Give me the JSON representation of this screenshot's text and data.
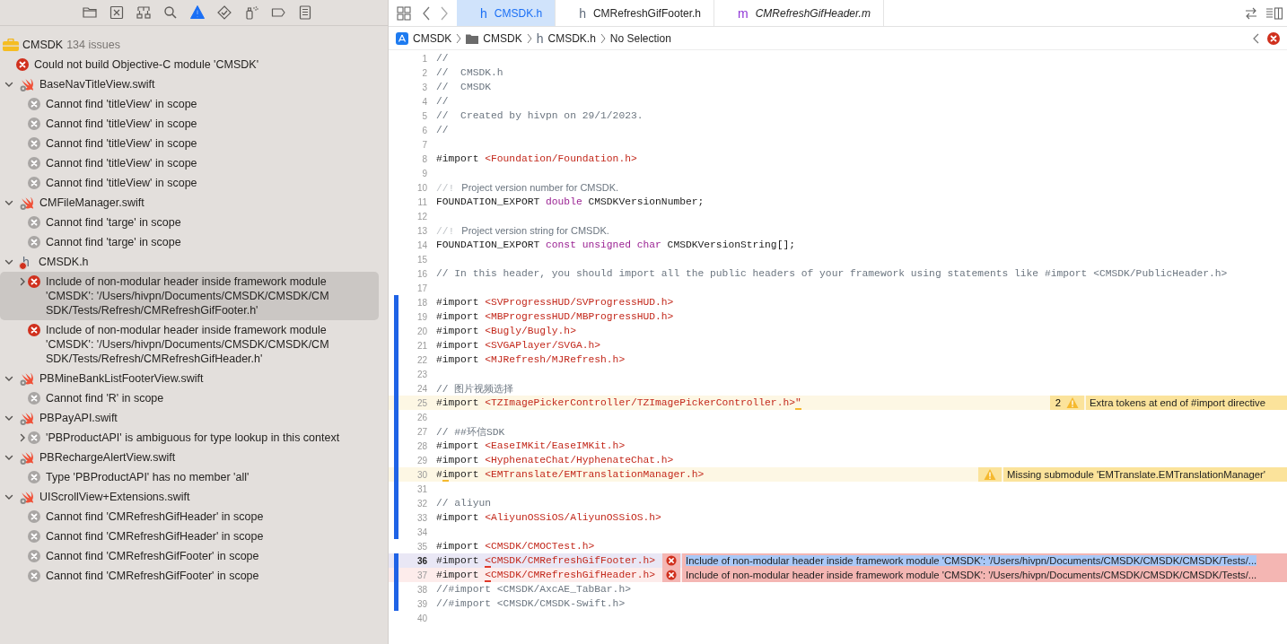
{
  "navigator_tabs": [
    {
      "kind": "project",
      "selected": false
    },
    {
      "kind": "source_control",
      "selected": false
    },
    {
      "kind": "symbols",
      "selected": false
    },
    {
      "kind": "find",
      "selected": false
    },
    {
      "kind": "issues",
      "selected": true
    },
    {
      "kind": "tests",
      "selected": false
    },
    {
      "kind": "debug",
      "selected": false
    },
    {
      "kind": "breakpoints",
      "selected": false
    },
    {
      "kind": "reports",
      "selected": false
    }
  ],
  "issues": {
    "project": "CMSDK",
    "count": "134 issues",
    "items": [
      {
        "kind": "error",
        "text": "Could not build Objective-C module 'CMSDK'",
        "selected": false
      },
      {
        "kind": "swift_file",
        "name": "BaseNavTitleView.swift",
        "expanded": true,
        "selected": false,
        "children": [
          {
            "kind": "stale",
            "text": "Cannot find 'titleView' in scope",
            "selected": false
          },
          {
            "kind": "stale",
            "text": "Cannot find 'titleView' in scope",
            "selected": false
          },
          {
            "kind": "stale",
            "text": "Cannot find 'titleView' in scope",
            "selected": false
          },
          {
            "kind": "stale",
            "text": "Cannot find 'titleView' in scope",
            "selected": false
          },
          {
            "kind": "stale",
            "text": "Cannot find 'titleView' in scope",
            "selected": false
          }
        ]
      },
      {
        "kind": "swift_file",
        "name": "CMFileManager.swift",
        "expanded": true,
        "selected": false,
        "children": [
          {
            "kind": "stale",
            "text": "Cannot find 'targe' in scope",
            "selected": false
          },
          {
            "kind": "stale",
            "text": "Cannot find 'targe' in scope",
            "selected": false
          }
        ]
      },
      {
        "kind": "header_file",
        "glyph": "h",
        "name": "CMSDK.h",
        "expanded": true,
        "selected": false,
        "children": [
          {
            "kind": "error",
            "text": "Include of non-modular header inside framework module 'CMSDK': '/Users/hivpn/Documents/CMSDK/CMSDK/CMSDK/Tests/Refresh/CMRefreshGifFooter.h'",
            "expanded": false,
            "selected": true
          },
          {
            "kind": "error",
            "text": "Include of non-modular header inside framework module 'CMSDK': '/Users/hivpn/Documents/CMSDK/CMSDK/CMSDK/Tests/Refresh/CMRefreshGifHeader.h'",
            "selected": false
          }
        ]
      },
      {
        "kind": "swift_file",
        "name": "PBMineBankListFooterView.swift",
        "expanded": true,
        "selected": false,
        "children": [
          {
            "kind": "stale",
            "text": "Cannot find 'R' in scope",
            "selected": false
          }
        ]
      },
      {
        "kind": "swift_file",
        "name": "PBPayAPI.swift",
        "expanded": true,
        "selected": false,
        "children": [
          {
            "kind": "stale",
            "text": "'PBProductAPI' is ambiguous for type lookup in this context",
            "expanded": false,
            "selected": false
          }
        ]
      },
      {
        "kind": "swift_file",
        "name": "PBRechargeAlertView.swift",
        "expanded": true,
        "selected": false,
        "children": [
          {
            "kind": "stale",
            "text": "Type 'PBProductAPI' has no member 'all'",
            "selected": false
          }
        ]
      },
      {
        "kind": "swift_file",
        "name": "UIScrollView+Extensions.swift",
        "expanded": true,
        "selected": false,
        "children": [
          {
            "kind": "stale",
            "text": "Cannot find 'CMRefreshGifHeader' in scope",
            "selected": false
          },
          {
            "kind": "stale",
            "text": "Cannot find 'CMRefreshGifHeader' in scope",
            "selected": false
          },
          {
            "kind": "stale",
            "text": "Cannot find 'CMRefreshGifFooter' in scope",
            "selected": false
          },
          {
            "kind": "stale",
            "text": "Cannot find 'CMRefreshGifFooter' in scope",
            "selected": false
          }
        ]
      }
    ]
  },
  "tabs": [
    {
      "glyph": "h",
      "kind": "header",
      "label": "CMSDK.h",
      "selected": true,
      "italic": false
    },
    {
      "glyph": "h",
      "kind": "header",
      "label": "CMRefreshGifFooter.h",
      "selected": false,
      "italic": false
    },
    {
      "glyph": "m",
      "kind": "implementation",
      "label": "CMRefreshGifHeader.m",
      "selected": false,
      "italic": true
    }
  ],
  "breadcrumbs": [
    {
      "kind": "project",
      "label": "CMSDK"
    },
    {
      "kind": "folder",
      "label": "CMSDK"
    },
    {
      "kind": "file",
      "glyph": "h",
      "label": "CMSDK.h"
    },
    {
      "kind": "plain",
      "label": "No Selection"
    }
  ],
  "code": [
    {
      "number": "1",
      "segments": [
        {
          "kind": "comment",
          "text": "//"
        }
      ]
    },
    {
      "number": "2",
      "segments": [
        {
          "kind": "comment",
          "text": "//  CMSDK.h"
        }
      ]
    },
    {
      "number": "3",
      "segments": [
        {
          "kind": "comment",
          "text": "//  CMSDK"
        }
      ]
    },
    {
      "number": "4",
      "segments": [
        {
          "kind": "comment",
          "text": "//"
        }
      ]
    },
    {
      "number": "5",
      "segments": [
        {
          "kind": "comment",
          "text": "//  Created by hivpn on 29/1/2023."
        }
      ]
    },
    {
      "number": "6",
      "segments": [
        {
          "kind": "comment",
          "text": "//"
        }
      ]
    },
    {
      "number": "7"
    },
    {
      "number": "8",
      "segments": [
        {
          "kind": "plain",
          "text": "#import "
        },
        {
          "kind": "string",
          "text": "<Foundation/Foundation.h>"
        }
      ]
    },
    {
      "number": "9"
    },
    {
      "number": "10",
      "segments": [
        {
          "kind": "marker",
          "text": "//!"
        },
        {
          "kind": "doc",
          "text": "Project version number for CMSDK."
        }
      ]
    },
    {
      "number": "11",
      "segments": [
        {
          "kind": "plain",
          "text": "FOUNDATION_EXPORT "
        },
        {
          "kind": "keyword",
          "text": "double"
        },
        {
          "kind": "plain",
          "text": " CMSDKVersionNumber;"
        }
      ]
    },
    {
      "number": "12"
    },
    {
      "number": "13",
      "segments": [
        {
          "kind": "marker",
          "text": "//!"
        },
        {
          "kind": "doc",
          "text": "Project version string for CMSDK."
        }
      ]
    },
    {
      "number": "14",
      "segments": [
        {
          "kind": "plain",
          "text": "FOUNDATION_EXPORT "
        },
        {
          "kind": "keyword",
          "text": "const unsigned char"
        },
        {
          "kind": "plain",
          "text": " CMSDKVersionString[];"
        }
      ]
    },
    {
      "number": "15"
    },
    {
      "number": "16",
      "segments": [
        {
          "kind": "comment",
          "text": "// In this header, you should import all the public headers of your framework using statements like #import <CMSDK/PublicHeader.h>"
        }
      ]
    },
    {
      "number": "17"
    },
    {
      "number": "18",
      "changed": true,
      "segments": [
        {
          "kind": "plain",
          "text": "#import "
        },
        {
          "kind": "string",
          "text": "<SVProgressHUD/SVProgressHUD.h>"
        }
      ]
    },
    {
      "number": "19",
      "changed": true,
      "segments": [
        {
          "kind": "plain",
          "text": "#import "
        },
        {
          "kind": "string",
          "text": "<MBProgressHUD/MBProgressHUD.h>"
        }
      ]
    },
    {
      "number": "20",
      "changed": true,
      "segments": [
        {
          "kind": "plain",
          "text": "#import "
        },
        {
          "kind": "string",
          "text": "<Bugly/Bugly.h>"
        }
      ]
    },
    {
      "number": "21",
      "changed": true,
      "segments": [
        {
          "kind": "plain",
          "text": "#import "
        },
        {
          "kind": "string",
          "text": "<SVGAPlayer/SVGA.h>"
        }
      ]
    },
    {
      "number": "22",
      "changed": true,
      "segments": [
        {
          "kind": "plain",
          "text": "#import "
        },
        {
          "kind": "string",
          "text": "<MJRefresh/MJRefresh.h>"
        }
      ]
    },
    {
      "number": "23",
      "changed": true
    },
    {
      "number": "24",
      "changed": true,
      "segments": [
        {
          "kind": "comment",
          "text": "// 图片视频选择"
        }
      ]
    },
    {
      "number": "25",
      "changed": true,
      "segments": [
        {
          "kind": "plain",
          "text": "#import "
        },
        {
          "kind": "string",
          "text": "<TZImagePickerController/TZImagePickerController.h>"
        },
        {
          "kind": "string",
          "text": "\"",
          "underlined": true
        }
      ],
      "annotation": {
        "kind": "warning",
        "count": "2",
        "message": "Extra tokens at end of #import directive",
        "selected": false
      }
    },
    {
      "number": "26",
      "changed": true
    },
    {
      "number": "27",
      "changed": true,
      "segments": [
        {
          "kind": "comment",
          "text": "// ##环信SDK"
        }
      ]
    },
    {
      "number": "28",
      "changed": true,
      "segments": [
        {
          "kind": "plain",
          "text": "#import "
        },
        {
          "kind": "string",
          "text": "<EaseIMKit/EaseIMKit.h>"
        }
      ]
    },
    {
      "number": "29",
      "changed": true,
      "segments": [
        {
          "kind": "plain",
          "text": "#import "
        },
        {
          "kind": "string",
          "text": "<HyphenateChat/HyphenateChat.h>"
        }
      ]
    },
    {
      "number": "30",
      "changed": true,
      "segments": [
        {
          "kind": "plain",
          "text": "#"
        },
        {
          "kind": "plain",
          "text": "i",
          "underlined": true
        },
        {
          "kind": "plain",
          "text": "mport "
        },
        {
          "kind": "string",
          "text": "<EMTranslate/EMTranslationManager.h>"
        }
      ],
      "annotation": {
        "kind": "warning",
        "message": "Missing submodule 'EMTranslate.EMTranslationManager'",
        "selected": false
      }
    },
    {
      "number": "31",
      "changed": true
    },
    {
      "number": "32",
      "changed": true,
      "segments": [
        {
          "kind": "comment",
          "text": "// aliyun"
        }
      ]
    },
    {
      "number": "33",
      "changed": true,
      "segments": [
        {
          "kind": "plain",
          "text": "#import "
        },
        {
          "kind": "string",
          "text": "<AliyunOSSiOS/AliyunOSSiOS.h>"
        }
      ]
    },
    {
      "number": "34",
      "changed": true
    },
    {
      "number": "35",
      "segments": [
        {
          "kind": "plain",
          "text": "#import "
        },
        {
          "kind": "string",
          "text": "<CMSDK/CMOCTest.h>"
        }
      ]
    },
    {
      "number": "36",
      "changed": true,
      "current": true,
      "segments": [
        {
          "kind": "plain",
          "text": "#import "
        },
        {
          "kind": "string",
          "text": "<",
          "underlined": true
        },
        {
          "kind": "string",
          "text": "CMSDK/CMRefreshGifFooter.h>"
        }
      ],
      "annotation": {
        "kind": "error",
        "message": "Include of non-modular header inside framework module 'CMSDK': '/Users/hivpn/Documents/CMSDK/CMSDK/CMSDK/Tests/...",
        "selected": true
      }
    },
    {
      "number": "37",
      "changed": true,
      "segments": [
        {
          "kind": "plain",
          "text": "#import "
        },
        {
          "kind": "string",
          "text": "<",
          "underlined": true
        },
        {
          "kind": "string",
          "text": "CMSDK/CMRefreshGifHeader.h>"
        }
      ],
      "annotation": {
        "kind": "error",
        "message": "Include of non-modular header inside framework module 'CMSDK': '/Users/hivpn/Documents/CMSDK/CMSDK/CMSDK/Tests/...",
        "selected": false
      }
    },
    {
      "number": "38",
      "changed": true,
      "segments": [
        {
          "kind": "comment",
          "text": "//#import <CMSDK/AxcAE_TabBar.h>"
        }
      ]
    },
    {
      "number": "39",
      "changed": true,
      "segments": [
        {
          "kind": "comment",
          "text": "//#import <CMSDK/CMSDK-Swift.h>"
        }
      ]
    },
    {
      "number": "40"
    }
  ]
}
